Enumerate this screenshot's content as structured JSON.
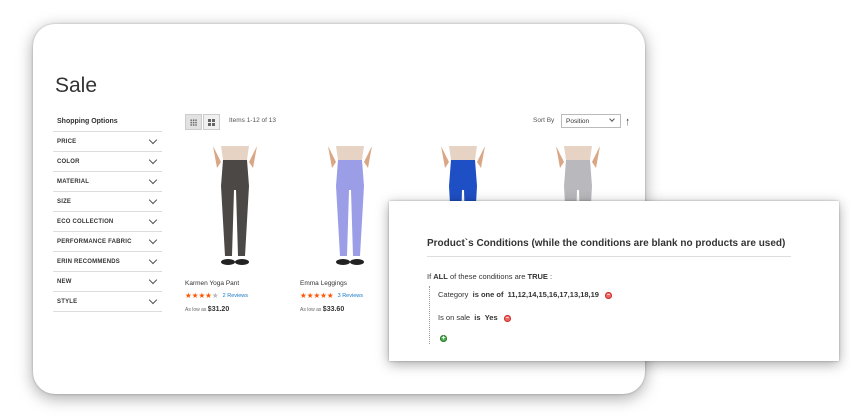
{
  "store": {
    "page_title": "Sale",
    "shop_title": "Shopping Options",
    "filters": [
      "PRICE",
      "COLOR",
      "MATERIAL",
      "SIZE",
      "ECO COLLECTION",
      "PERFORMANCE FABRIC",
      "ERIN RECOMMENDS",
      "NEW",
      "STYLE"
    ],
    "toolbar": {
      "items_count": "Items 1-12 of 13",
      "sort_label": "Sort By",
      "sort_value": "Position",
      "sort_direction_icon": "arrow-up-icon",
      "view_modes": [
        "grid",
        "list"
      ]
    },
    "products": [
      {
        "name": "Karmen Yoga Pant",
        "rating": 4,
        "reviews": "2  Reviews",
        "price_prefix": "As low as",
        "price": "$31.20",
        "color": "#4b4846"
      },
      {
        "name": "Emma Leggings",
        "rating": 5,
        "reviews": "3  Reviews",
        "price_prefix": "As low as",
        "price": "$33.60",
        "color": "#9b9ee6"
      },
      {
        "name": "",
        "rating": 0,
        "reviews": "",
        "price_prefix": "",
        "price": "",
        "color": "#1f4fc4"
      },
      {
        "name": "",
        "rating": 0,
        "reviews": "",
        "price_prefix": "",
        "price": "",
        "color": "#b9b9bd"
      }
    ]
  },
  "conditions": {
    "title": "Product`s Conditions (while the conditions are blank no products are used)",
    "if_prefix": "If",
    "aggregator": "ALL",
    "middle_text": "of these conditions are",
    "value": "TRUE",
    "suffix": ":",
    "rule1": {
      "attribute": "Category",
      "operator": "is one of",
      "value": "11,12,14,15,16,17,13,18,19"
    },
    "rule2": {
      "attribute": "Is on sale",
      "operator": "is",
      "value": "Yes"
    }
  },
  "colors": {
    "star": "#ff5501",
    "link": "#1979c3",
    "remove": "#e66666",
    "add": "#4caf50"
  }
}
